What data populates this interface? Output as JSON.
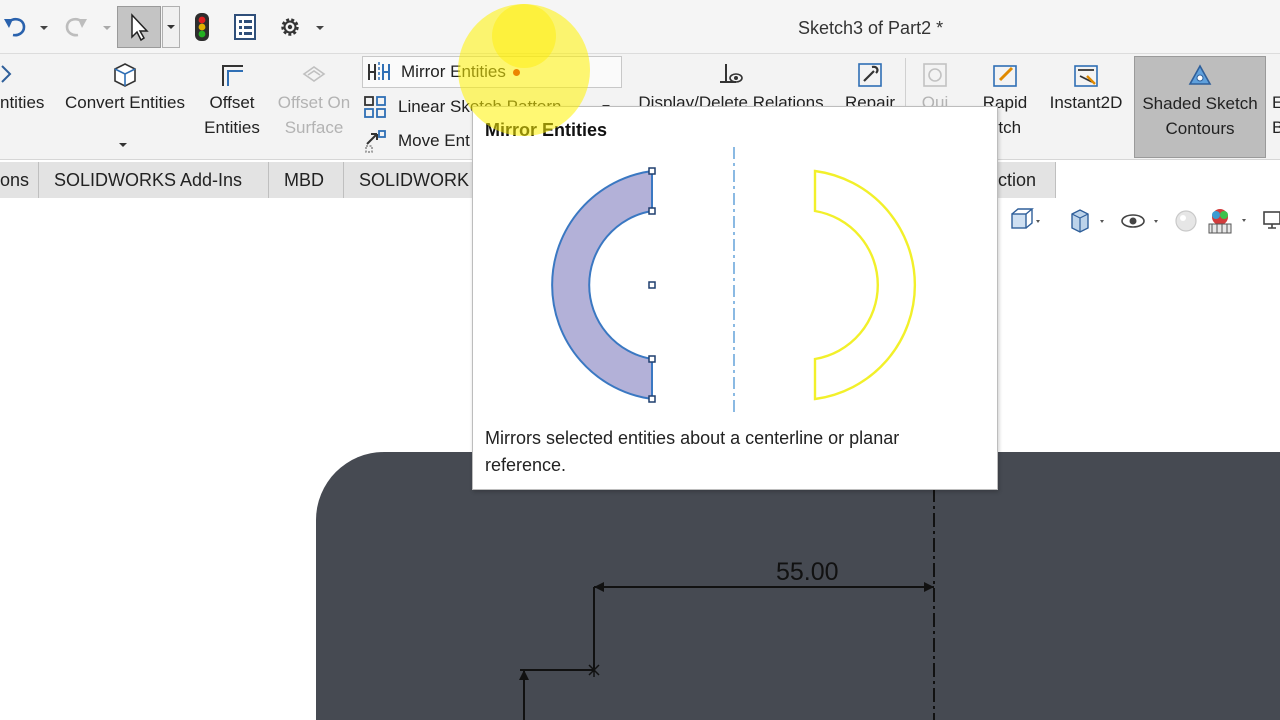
{
  "titlebar": {
    "document_title": "Sketch3 of Part2 *",
    "icons": [
      "undo-icon",
      "redo-icon",
      "select-arrow-icon",
      "rebuild-icon",
      "file-properties-icon",
      "options-gear-icon"
    ]
  },
  "ribbon": {
    "convert_entities_partial": "ntities",
    "convert_entities": "Convert Entities",
    "offset_entities_line1": "Offset",
    "offset_entities_line2": "Entities",
    "offset_on_surface_line1": "Offset On",
    "offset_on_surface_line2": "Surface",
    "mirror_entities": "Mirror Entities",
    "linear_sketch_pattern": "Linear Sketch Pattern",
    "move_entities": "Move Ent",
    "display_delete_relations": "Display/Delete Relations",
    "repair": "Repair",
    "quick": "Qui",
    "rapid_sketch_line1": "Rapid",
    "rapid_sketch_line2": "etch",
    "instant2d": "Instant2D",
    "shaded_sketch_line1": "Shaded Sketch",
    "shaded_sketch_line2": "Contours",
    "cut_off_e": "E",
    "cut_off_b": "B"
  },
  "tabs": {
    "partial_left": "ons",
    "addins": "SOLIDWORKS Add-Ins",
    "mbd": "MBD",
    "solidworks_partial": "SOLIDWORK",
    "right_partial": "ction"
  },
  "tooltip": {
    "title": "Mirror Entities",
    "description": "Mirrors selected entities about a centerline or planar reference."
  },
  "canvas": {
    "dimension": "55.00"
  },
  "colors": {
    "accent_blue": "#3a78c2",
    "mirror_fill": "#b3b1d8",
    "mirror_result": "#f2f02a",
    "part_face": "#464a52",
    "highlight_yellow": "#fff200"
  }
}
